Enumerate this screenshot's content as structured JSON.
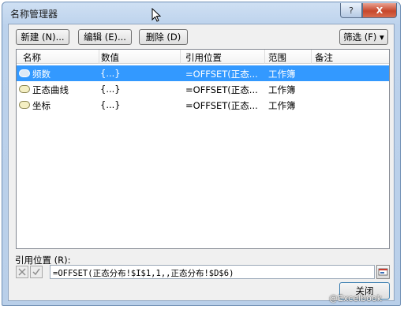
{
  "window": {
    "title": "名称管理器",
    "help_glyph": "?",
    "close_glyph": "X"
  },
  "toolbar": {
    "new_label": "新建 (N)...",
    "edit_label": "编辑 (E)...",
    "delete_label": "删除 (D)",
    "filter_label": "筛选 (F) ▾"
  },
  "list": {
    "columns": [
      "名称",
      "数值",
      "引用位置",
      "范围",
      "备注"
    ],
    "rows": [
      {
        "name": "频数",
        "value": "{...}",
        "ref": "=OFFSET(正态...",
        "scope": "工作簿",
        "note": "",
        "selected": true
      },
      {
        "name": "正态曲线",
        "value": "{...}",
        "ref": "=OFFSET(正态...",
        "scope": "工作簿",
        "note": "",
        "selected": false
      },
      {
        "name": "坐标",
        "value": "{...}",
        "ref": "=OFFSET(正态...",
        "scope": "工作簿",
        "note": "",
        "selected": false
      }
    ]
  },
  "refers_to": {
    "label": "引用位置 (R):",
    "value": "=OFFSET(正态分布!$I$1,1,,正态分布!$D$6)"
  },
  "footer": {
    "close_label": "关闭"
  },
  "watermark": "@Excelbook"
}
